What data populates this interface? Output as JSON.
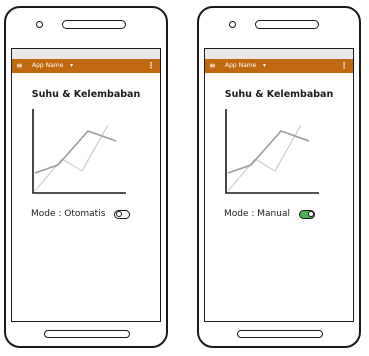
{
  "phones": [
    {
      "app_title": "App Name",
      "heading": "Suhu & Kelembaban",
      "mode_label": "Mode : Otomatis",
      "toggle_on": false
    },
    {
      "app_title": "App Name",
      "heading": "Suhu & Kelembaban",
      "mode_label": "Mode : Manual",
      "toggle_on": true
    }
  ],
  "icons": {
    "menu": "≡",
    "dropdown": "▾",
    "more": "⋮"
  },
  "colors": {
    "appbar": "#c0690e",
    "toggle_on": "#4caf50"
  }
}
